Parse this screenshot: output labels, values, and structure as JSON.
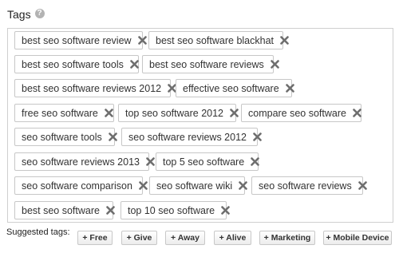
{
  "tags_section": {
    "title": "Tags",
    "help_icon": "question-circle-icon",
    "remove_icon": "x-icon",
    "tags": [
      "best seo software review",
      "best seo software blackhat",
      "best seo software tools",
      "best seo software reviews",
      "best seo software reviews 2012",
      "effective seo software",
      "free seo software",
      "top seo software 2012",
      "compare seo software",
      "seo software tools",
      "seo software reviews 2012",
      "seo software reviews 2013",
      "top 5 seo software",
      "seo software comparison",
      "seo software wiki",
      "seo software reviews",
      "best seo software",
      "top 10 seo software"
    ]
  },
  "suggested": {
    "label": "Suggested tags:",
    "items": [
      "+ Free",
      "+ Give",
      "+ Away",
      "+ Alive",
      "+ Marketing",
      "+ Mobile Device"
    ]
  }
}
